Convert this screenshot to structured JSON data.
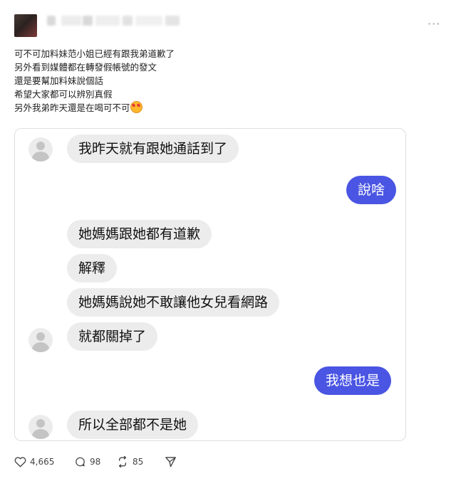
{
  "post": {
    "lines": [
      "可不可加料妹范小姐已經有跟我弟道歉了",
      "另外看到媒體都在轉發假帳號的發文",
      "還是要幫加料妹說個話",
      "希望大家都可以辨別真假",
      "另外我弟昨天還是在喝可不可"
    ],
    "more_label": "···"
  },
  "chat": {
    "messages": [
      {
        "side": "in",
        "text": "我昨天就有跟她通話到了"
      },
      {
        "side": "out",
        "text": "說啥"
      },
      {
        "side": "in",
        "text": "她媽媽跟她都有道歉"
      },
      {
        "side": "in",
        "text": "解釋"
      },
      {
        "side": "in",
        "text": "她媽媽說她不敢讓他女兒看網路"
      },
      {
        "side": "in",
        "text": "就都關掉了"
      },
      {
        "side": "out",
        "text": "我想也是"
      },
      {
        "side": "in",
        "text": "所以全部都不是她"
      }
    ]
  },
  "actions": {
    "likes": "4,665",
    "comments": "98",
    "reposts": "85"
  },
  "icons": [
    "heart-icon",
    "comment-icon",
    "repost-icon",
    "share-icon",
    "more-icon",
    "default-avatar-icon"
  ],
  "colors": {
    "outgoing_bubble": "#4a55e3",
    "incoming_bubble": "#ececec"
  }
}
